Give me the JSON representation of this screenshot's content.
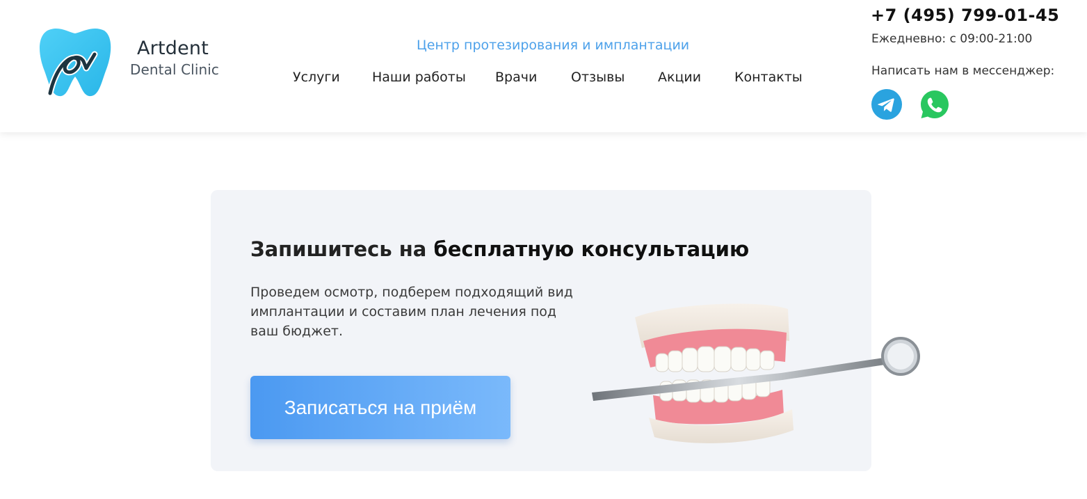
{
  "header": {
    "logo": {
      "name": "Artdent",
      "subtitle": "Dental Clinic"
    },
    "tagline": "Центр протезирования и имплантации",
    "nav": [
      {
        "label": "Услуги"
      },
      {
        "label": "Наши работы"
      },
      {
        "label": "Врачи"
      },
      {
        "label": "Отзывы"
      },
      {
        "label": "Акции"
      },
      {
        "label": "Контакты"
      }
    ],
    "contacts": {
      "phone": "+7 (495) 799-01-45",
      "hours": "Ежедневно: с 09:00-21:00",
      "messenger_label": "Написать нам в мессенджер:",
      "messengers": [
        {
          "icon": "telegram-icon",
          "color": "#2aa3df"
        },
        {
          "icon": "whatsapp-icon",
          "color": "#29c75f"
        }
      ]
    }
  },
  "promo": {
    "title_regular": "Запишитесь на ",
    "title_bold": "бесплатную консультацию",
    "text": "Проведем осмотр, подберем подходящий вид имплантации и составим план лечения под ваш бюджет.",
    "button_label": "Записаться на приём"
  },
  "colors": {
    "accent": "#4da1ea",
    "button_gradient_start": "#4b99f1",
    "button_gradient_end": "#7ab9fb",
    "card_background": "#f2f4f8",
    "logo_blue": "#3cc3f0",
    "logo_dark": "#1d3440"
  }
}
